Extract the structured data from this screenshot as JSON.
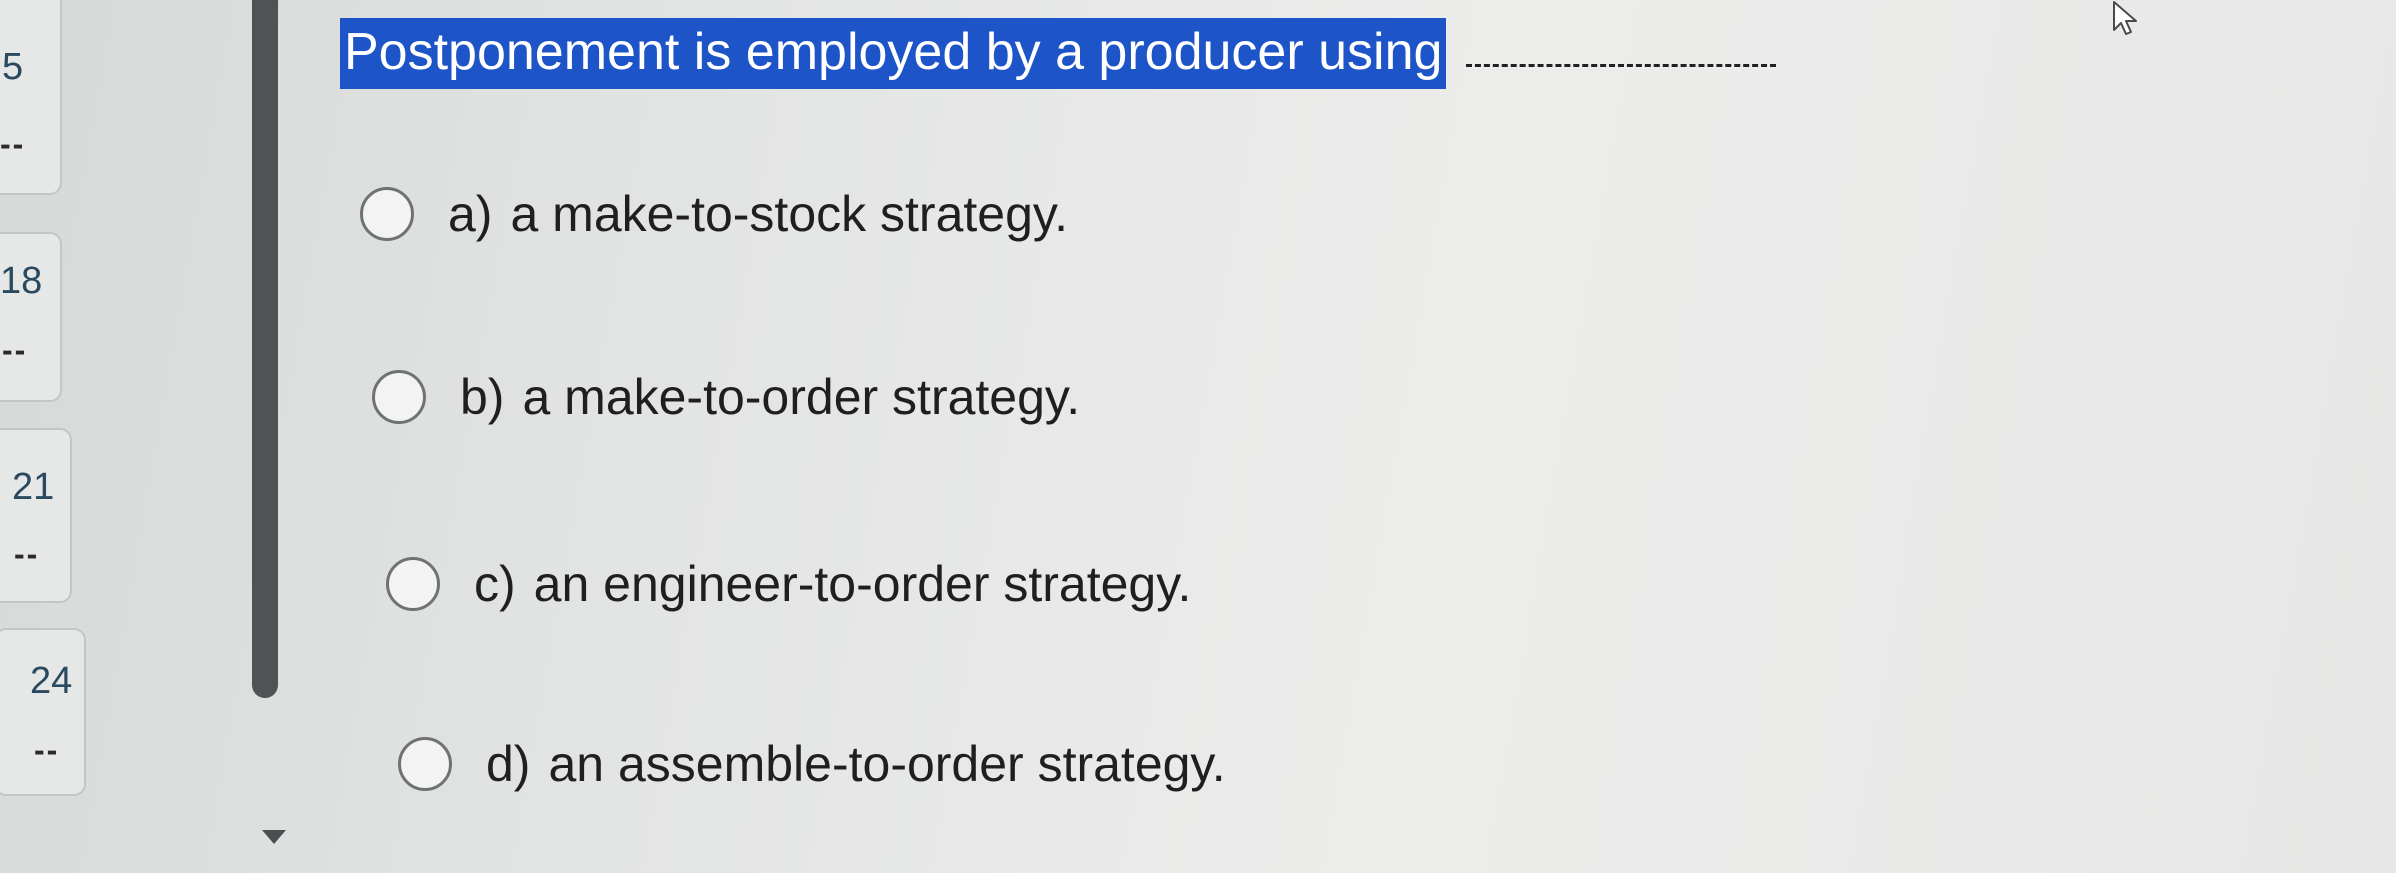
{
  "navigator": {
    "items": [
      {
        "number": "5",
        "status": "--"
      },
      {
        "number": "18",
        "status": "--"
      },
      {
        "number": "21",
        "status": "--"
      },
      {
        "number": "24",
        "status": "--"
      }
    ]
  },
  "question": {
    "text": "Postponement is employed by a producer using",
    "highlight_color": "#1d54c8"
  },
  "options": [
    {
      "letter": "a)",
      "text": "a make-to-stock strategy."
    },
    {
      "letter": "b)",
      "text": "a make-to-order strategy."
    },
    {
      "letter": "c)",
      "text": "an engineer-to-order strategy."
    },
    {
      "letter": "d)",
      "text": "an assemble-to-order strategy."
    }
  ],
  "icons": {
    "cursor": "mouse-pointer-icon",
    "scroll": "scroll-down-arrow-icon"
  }
}
